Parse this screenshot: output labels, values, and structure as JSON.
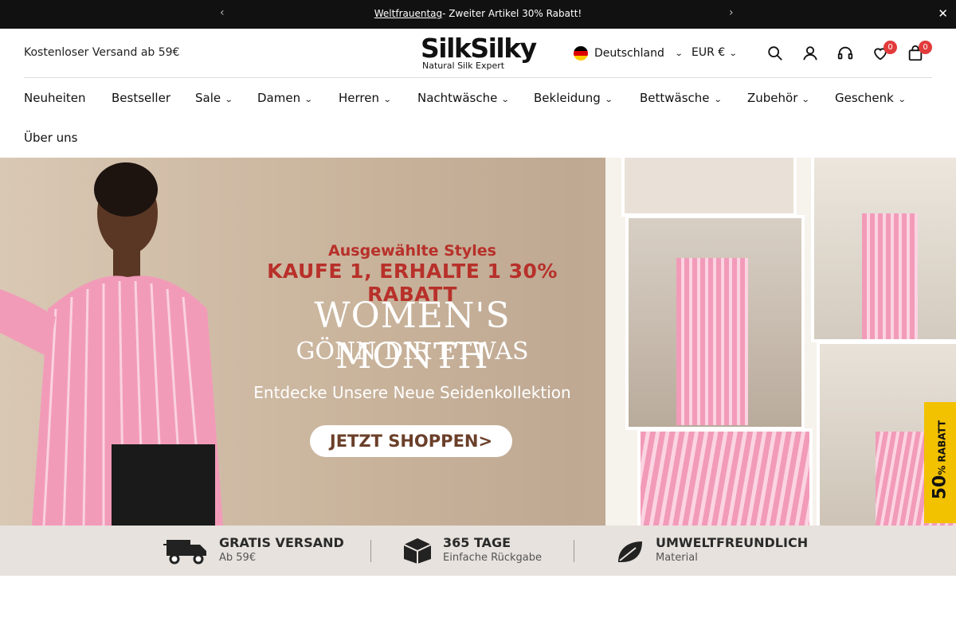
{
  "announcement": {
    "link_text": "Weltfrauentag",
    "text": "- Zweiter Artikel 30% Rabatt!"
  },
  "header": {
    "shipping_note": "Kostenloser Versand ab 59€",
    "logo_main": "SilkSilky",
    "logo_sub": "Natural Silk Expert",
    "country": "Deutschland",
    "currency": "EUR €",
    "wishlist_count": "0",
    "cart_count": "0"
  },
  "nav": [
    "Neuheiten",
    "Bestseller",
    "Sale",
    "Damen",
    "Herren",
    "Nachtwäsche",
    "Bekleidung",
    "Bettwäsche",
    "Zubehör",
    "Geschenk",
    "Über uns"
  ],
  "banner": {
    "line1": "Ausgewählte Styles",
    "line2": "KAUFE 1, ERHALTE 1 30% RABATT",
    "line3": "WOMEN'S MONTH",
    "line4": "GÖNN DIR ETWAS",
    "line5": "Entdecke Unsere Neue Seidenkollektion",
    "cta": "JETZT SHOPPEN>"
  },
  "side_tab": {
    "number": "50",
    "text": "% RABATT"
  },
  "features": [
    {
      "title": "GRATIS VERSAND",
      "sub": "Ab 59€"
    },
    {
      "title": "365 TAGE",
      "sub": "Einfache Rückgabe"
    },
    {
      "title": "UMWELTFREUNDLICH",
      "sub": "Material"
    }
  ],
  "colors": {
    "accent": "#b8302a",
    "badge": "#e23b3b",
    "side_tab": "#f2c100"
  }
}
